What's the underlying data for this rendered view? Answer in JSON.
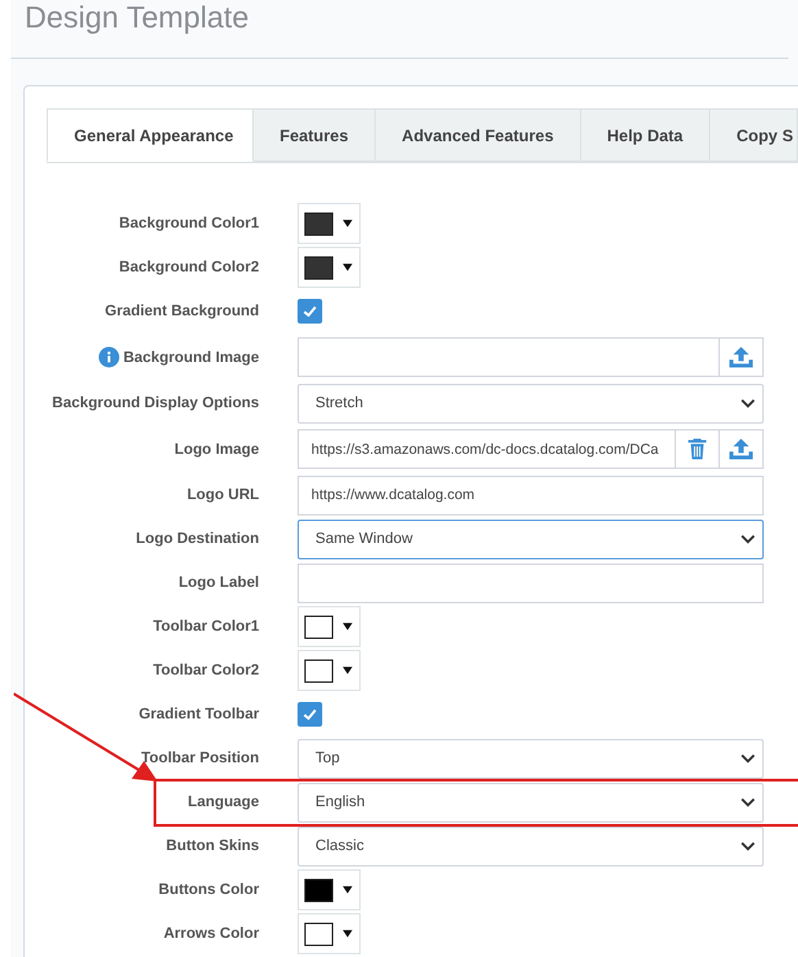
{
  "page": {
    "title": "Design Template"
  },
  "tabs": [
    {
      "label": "General Appearance",
      "selected": true
    },
    {
      "label": "Features",
      "selected": false
    },
    {
      "label": "Advanced Features",
      "selected": false
    },
    {
      "label": "Help Data",
      "selected": false
    },
    {
      "label": "Copy S",
      "selected": false
    }
  ],
  "rows": [
    {
      "kind": "color",
      "label": "Background Color1",
      "color": "#333333"
    },
    {
      "kind": "color",
      "label": "Background Color2",
      "color": "#333333"
    },
    {
      "kind": "checkbox",
      "label": "Gradient Background",
      "checked": true
    },
    {
      "kind": "file",
      "label": "Background Image",
      "info": true,
      "value": "",
      "deletable": false
    },
    {
      "kind": "select",
      "label": "Background Display Options",
      "value": "Stretch",
      "focused": false
    },
    {
      "kind": "file",
      "label": "Logo Image",
      "info": false,
      "value": "https://s3.amazonaws.com/dc-docs.dcatalog.com/DCa",
      "deletable": true
    },
    {
      "kind": "text",
      "label": "Logo URL",
      "value": "https://www.dcatalog.com"
    },
    {
      "kind": "select",
      "label": "Logo Destination",
      "value": "Same Window",
      "focused": true
    },
    {
      "kind": "text",
      "label": "Logo Label",
      "value": ""
    },
    {
      "kind": "color",
      "label": "Toolbar Color1",
      "color": "#ffffff"
    },
    {
      "kind": "color",
      "label": "Toolbar Color2",
      "color": "#ffffff"
    },
    {
      "kind": "checkbox",
      "label": "Gradient Toolbar",
      "checked": true
    },
    {
      "kind": "select",
      "label": "Toolbar Position",
      "value": "Top",
      "focused": false
    },
    {
      "kind": "select",
      "label": "Language",
      "value": "English",
      "focused": false,
      "highlighted": true
    },
    {
      "kind": "select",
      "label": "Button Skins",
      "value": "Classic",
      "focused": false
    },
    {
      "kind": "color",
      "label": "Buttons Color",
      "color": "#000000"
    },
    {
      "kind": "color",
      "label": "Arrows Color",
      "color": "#ffffff"
    }
  ]
}
